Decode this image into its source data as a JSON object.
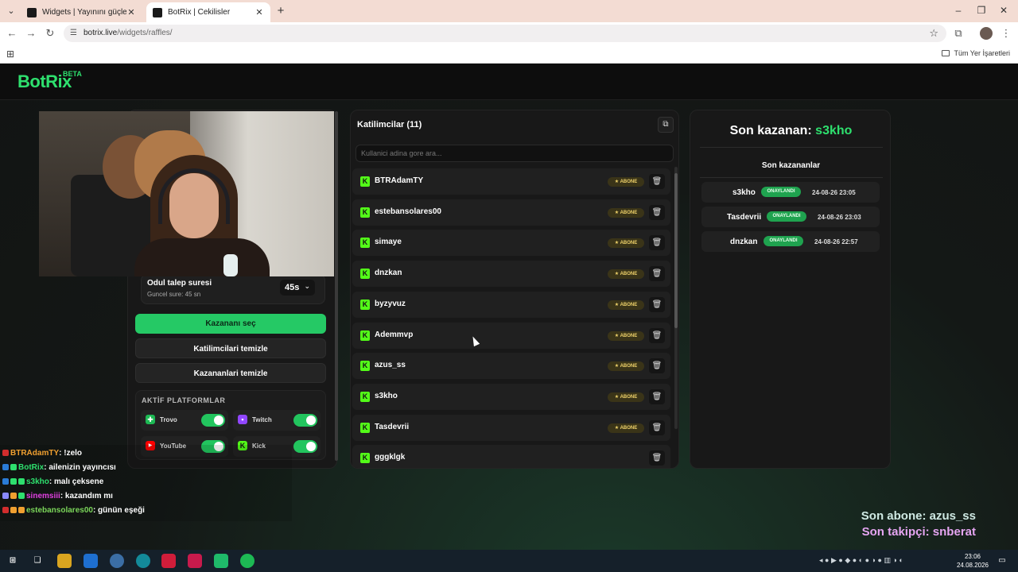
{
  "browser": {
    "tabs": [
      {
        "title": "Widgets | Yayınını güçlendirmek",
        "active": false,
        "favicon_color": "#1a1a1a"
      },
      {
        "title": "BotRix | Cekilisler",
        "active": true,
        "favicon_color": "#1a1a1a"
      }
    ],
    "new_tab_icon": "plus-icon",
    "url_domain": "botrix.live",
    "url_path": "/widgets/raffles/",
    "bookmarks_all": "Tüm Yer İşaretleri"
  },
  "site": {
    "logo": "BotRix",
    "logo_badge": "BETA"
  },
  "raffle_settings": {
    "claim_title": "Odul talep suresi",
    "claim_sub": "Guncel sure: 45 sn",
    "claim_value": "45s",
    "pick_winner": "Kazananı seç",
    "clear_participants": "Katilimcilari temizle",
    "clear_winners": "Kazananlari temizle",
    "platforms_title": "AKTİF PLATFORMLAR",
    "platforms": [
      {
        "name": "Trovo",
        "color": "#1db954",
        "enabled": true
      },
      {
        "name": "Twitch",
        "color": "#9146ff",
        "enabled": true
      },
      {
        "name": "YouTube",
        "color": "#ff0000",
        "enabled": true
      },
      {
        "name": "Kick",
        "color": "#53fc18",
        "enabled": true
      }
    ]
  },
  "participants": {
    "title": "Katilimcilar (11)",
    "search_placeholder": "Kullanici adina gore ara...",
    "items": [
      {
        "name": "BTRAdamTY",
        "badge": "ABONE"
      },
      {
        "name": "estebansolares00",
        "badge": "ABONE"
      },
      {
        "name": "simaye",
        "badge": "ABONE"
      },
      {
        "name": "dnzkan",
        "badge": "ABONE"
      },
      {
        "name": "byzyvuz",
        "badge": "ABONE"
      },
      {
        "name": "Ademmvp",
        "badge": "ABONE"
      },
      {
        "name": "azus_ss",
        "badge": "ABONE"
      },
      {
        "name": "s3kho",
        "badge": "ABONE"
      },
      {
        "name": "Tasdevrii",
        "badge": "ABONE"
      },
      {
        "name": "gggklgk",
        "badge": ""
      }
    ]
  },
  "winners": {
    "last_winner_label": "Son kazanan:",
    "last_winner_name": "s3kho",
    "subtitle": "Son kazananlar",
    "items": [
      {
        "name": "s3kho",
        "status": "ONAYLANDI",
        "date": "24-08-26 23:05"
      },
      {
        "name": "Tasdevrii",
        "status": "ONAYLANDI",
        "date": "24-08-26 23:03"
      },
      {
        "name": "dnzkan",
        "status": "ONAYLANDI",
        "date": "24-08-26 22:57"
      }
    ]
  },
  "chat": [
    {
      "user": "BTRAdamTY",
      "user_color": "#f0a030",
      "message": " : !zelo"
    },
    {
      "user": "BotRix",
      "user_color": "#2ee06e",
      "message": " : ailenizin yayıncısı"
    },
    {
      "user": "s3kho",
      "user_color": "#2ee06e",
      "message": " : malı çeksene"
    },
    {
      "user": "sinemsiii",
      "user_color": "#e040e0",
      "message": " : kazandım mı"
    },
    {
      "user": "estebansolares00",
      "user_color": "#7bd65a",
      "message": " : günün eşeği"
    }
  ],
  "stream_overlay": {
    "last_sub": "Son abone: azus_ss",
    "last_follower": "Son takipçi: snberat"
  },
  "taskbar": {
    "time": "23:06",
    "date": "24.08.2026"
  }
}
